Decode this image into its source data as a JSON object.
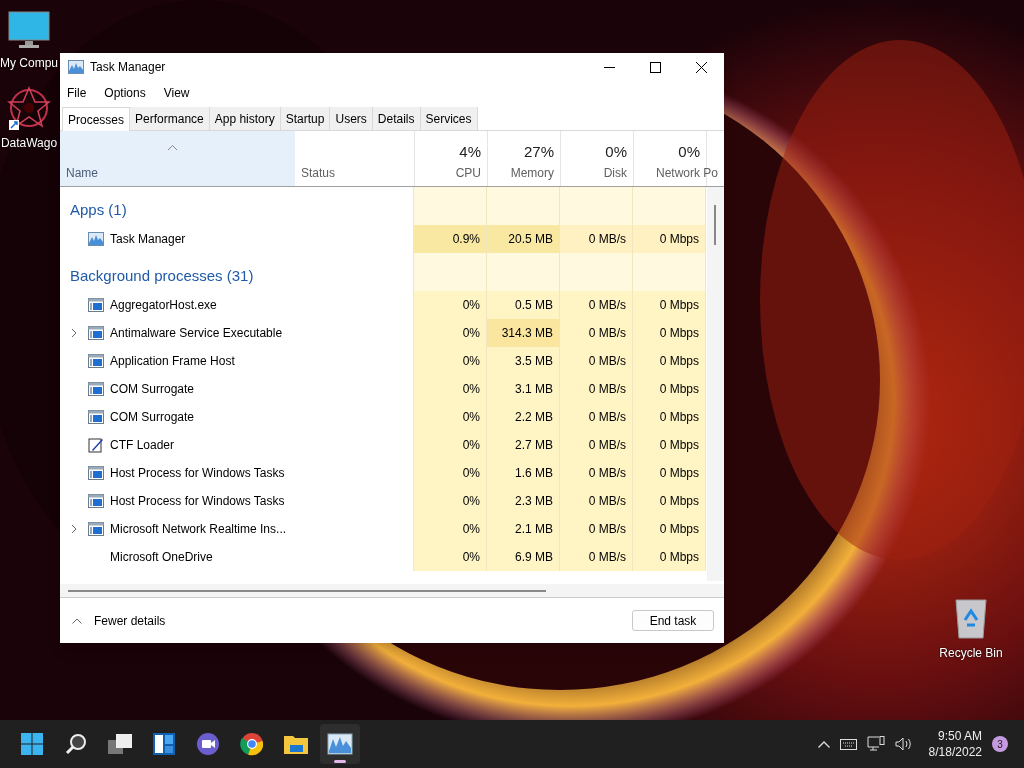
{
  "desktop_icons": [
    {
      "label": "My Compu",
      "kind": "monitor"
    },
    {
      "label": "DataWago",
      "kind": "star"
    },
    {
      "label": "Recycle Bin",
      "kind": "bin"
    }
  ],
  "window": {
    "title": "Task Manager"
  },
  "menu": [
    "File",
    "Options",
    "View"
  ],
  "tabs": [
    {
      "label": "Processes",
      "selected": true
    },
    {
      "label": "Performance",
      "selected": false
    },
    {
      "label": "App history",
      "selected": false
    },
    {
      "label": "Startup",
      "selected": false
    },
    {
      "label": "Users",
      "selected": false
    },
    {
      "label": "Details",
      "selected": false
    },
    {
      "label": "Services",
      "selected": false
    }
  ],
  "columns": [
    {
      "label": "Name"
    },
    {
      "label": "Status"
    },
    {
      "label": "CPU",
      "total": "4%"
    },
    {
      "label": "Memory",
      "total": "27%"
    },
    {
      "label": "Disk",
      "total": "0%"
    },
    {
      "label": "Network",
      "total": "0%"
    },
    {
      "label": "Po"
    }
  ],
  "groups": [
    {
      "title": "Apps (1)",
      "rows": [
        {
          "name": "Task Manager",
          "kind": "graph",
          "expandable": false,
          "cells": [
            {
              "value": "0.9%",
              "color": "#f9e8a2"
            },
            {
              "value": "20.5 MB",
              "color": "#f9e8a2"
            },
            {
              "value": "0 MB/s",
              "color": "#fff1c2"
            },
            {
              "value": "0 Mbps",
              "color": "#fff1c2"
            }
          ]
        }
      ]
    },
    {
      "title": "Background processes (31)",
      "rows": [
        {
          "name": "AggregatorHost.exe",
          "kind": "window",
          "expandable": false,
          "cells": [
            {
              "value": "0%",
              "color": "#fff4c4"
            },
            {
              "value": "0.5 MB",
              "color": "#fff4c4"
            },
            {
              "value": "0 MB/s",
              "color": "#fff4c4"
            },
            {
              "value": "0 Mbps",
              "color": "#fff4c4"
            }
          ]
        },
        {
          "name": "Antimalware Service Executable",
          "kind": "window",
          "expandable": true,
          "cells": [
            {
              "value": "0%",
              "color": "#fff4c4"
            },
            {
              "value": "314.3 MB",
              "color": "#fbe6a0"
            },
            {
              "value": "0 MB/s",
              "color": "#fff4c4"
            },
            {
              "value": "0 Mbps",
              "color": "#fff4c4"
            }
          ]
        },
        {
          "name": "Application Frame Host",
          "kind": "window",
          "expandable": false,
          "cells": [
            {
              "value": "0%",
              "color": "#fff4c4"
            },
            {
              "value": "3.5 MB",
              "color": "#fff4c4"
            },
            {
              "value": "0 MB/s",
              "color": "#fff4c4"
            },
            {
              "value": "0 Mbps",
              "color": "#fff4c4"
            }
          ]
        },
        {
          "name": "COM Surrogate",
          "kind": "window",
          "expandable": false,
          "cells": [
            {
              "value": "0%",
              "color": "#fff4c4"
            },
            {
              "value": "3.1 MB",
              "color": "#fff4c4"
            },
            {
              "value": "0 MB/s",
              "color": "#fff4c4"
            },
            {
              "value": "0 Mbps",
              "color": "#fff4c4"
            }
          ]
        },
        {
          "name": "COM Surrogate",
          "kind": "window",
          "expandable": false,
          "cells": [
            {
              "value": "0%",
              "color": "#fff4c4"
            },
            {
              "value": "2.2 MB",
              "color": "#fff4c4"
            },
            {
              "value": "0 MB/s",
              "color": "#fff4c4"
            },
            {
              "value": "0 Mbps",
              "color": "#fff4c4"
            }
          ]
        },
        {
          "name": "CTF Loader",
          "kind": "pen",
          "expandable": false,
          "cells": [
            {
              "value": "0%",
              "color": "#fff4c4"
            },
            {
              "value": "2.7 MB",
              "color": "#fff4c4"
            },
            {
              "value": "0 MB/s",
              "color": "#fff4c4"
            },
            {
              "value": "0 Mbps",
              "color": "#fff4c4"
            }
          ]
        },
        {
          "name": "Host Process for Windows Tasks",
          "kind": "window",
          "expandable": false,
          "cells": [
            {
              "value": "0%",
              "color": "#fff4c4"
            },
            {
              "value": "1.6 MB",
              "color": "#fff4c4"
            },
            {
              "value": "0 MB/s",
              "color": "#fff4c4"
            },
            {
              "value": "0 Mbps",
              "color": "#fff4c4"
            }
          ]
        },
        {
          "name": "Host Process for Windows Tasks",
          "kind": "window",
          "expandable": false,
          "cells": [
            {
              "value": "0%",
              "color": "#fff4c4"
            },
            {
              "value": "2.3 MB",
              "color": "#fff4c4"
            },
            {
              "value": "0 MB/s",
              "color": "#fff4c4"
            },
            {
              "value": "0 Mbps",
              "color": "#fff4c4"
            }
          ]
        },
        {
          "name": "Microsoft Network Realtime Ins...",
          "kind": "window",
          "expandable": true,
          "cells": [
            {
              "value": "0%",
              "color": "#fff4c4"
            },
            {
              "value": "2.1 MB",
              "color": "#fff4c4"
            },
            {
              "value": "0 MB/s",
              "color": "#fff4c4"
            },
            {
              "value": "0 Mbps",
              "color": "#fff4c4"
            }
          ]
        },
        {
          "name": "Microsoft OneDrive",
          "kind": "none",
          "expandable": false,
          "cells": [
            {
              "value": "0%",
              "color": "#fff4c4"
            },
            {
              "value": "6.9 MB",
              "color": "#fff4c4"
            },
            {
              "value": "0 MB/s",
              "color": "#fff4c4"
            },
            {
              "value": "0 Mbps",
              "color": "#fff4c4"
            }
          ]
        }
      ]
    }
  ],
  "footer": {
    "toggle": "Fewer details",
    "button": "End task"
  },
  "taskbar": {
    "apps": [
      {
        "kind": "start",
        "active": false
      },
      {
        "kind": "search",
        "active": false
      },
      {
        "kind": "taskview",
        "active": false
      },
      {
        "kind": "widgets",
        "active": false
      },
      {
        "kind": "chat",
        "active": false
      },
      {
        "kind": "chrome",
        "active": false
      },
      {
        "kind": "folder",
        "active": false
      },
      {
        "kind": "taskmgr",
        "active": true
      }
    ],
    "time": "9:50 AM",
    "date": "8/18/2022",
    "notifications": "3"
  }
}
